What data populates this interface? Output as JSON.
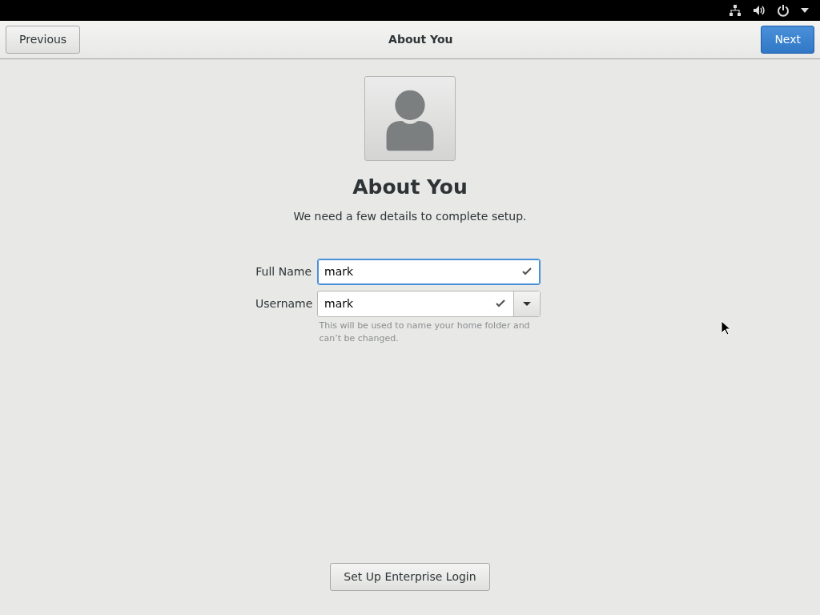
{
  "header": {
    "title": "About You",
    "previous_button": "Previous",
    "next_button": "Next"
  },
  "heading": "About You",
  "subtitle": "We need a few details to complete setup.",
  "fields": [
    {
      "label": "Full Name",
      "value": "mark",
      "focused": true,
      "has_dropdown": false
    },
    {
      "label": "Username",
      "value": "mark",
      "focused": false,
      "has_dropdown": true
    }
  ],
  "hint": "This will be used to name your home folder and can’t be changed.",
  "enterprise_button": "Set Up Enterprise Login"
}
